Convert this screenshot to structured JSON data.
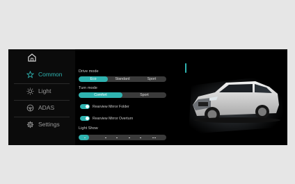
{
  "sidebar": {
    "items": [
      {
        "label": "Common",
        "icon": "star-icon",
        "active": true
      },
      {
        "label": "Light",
        "icon": "sun-icon",
        "active": false
      },
      {
        "label": "ADAS",
        "icon": "steering-wheel-icon",
        "active": false
      },
      {
        "label": "Settings",
        "icon": "gear-icon",
        "active": false
      }
    ],
    "home_icon": "home-icon"
  },
  "drive_mode": {
    "label": "Drive mode",
    "options": [
      "Eco",
      "Standard",
      "Sport"
    ],
    "selected": "Eco"
  },
  "turn_mode": {
    "label": "Turn mode",
    "options": [
      "Comfort",
      "Sport"
    ],
    "selected": "Comfort"
  },
  "toggles": [
    {
      "label": "Rearview Mirror Folder",
      "on": true
    },
    {
      "label": "Rearview Mirror Overturn",
      "on": true
    }
  ],
  "light_show": {
    "label": "Light Show",
    "level": 0.12
  },
  "colors": {
    "accent": "#2fb3b0",
    "background": "#000000",
    "frame": "#e6e6e6"
  }
}
